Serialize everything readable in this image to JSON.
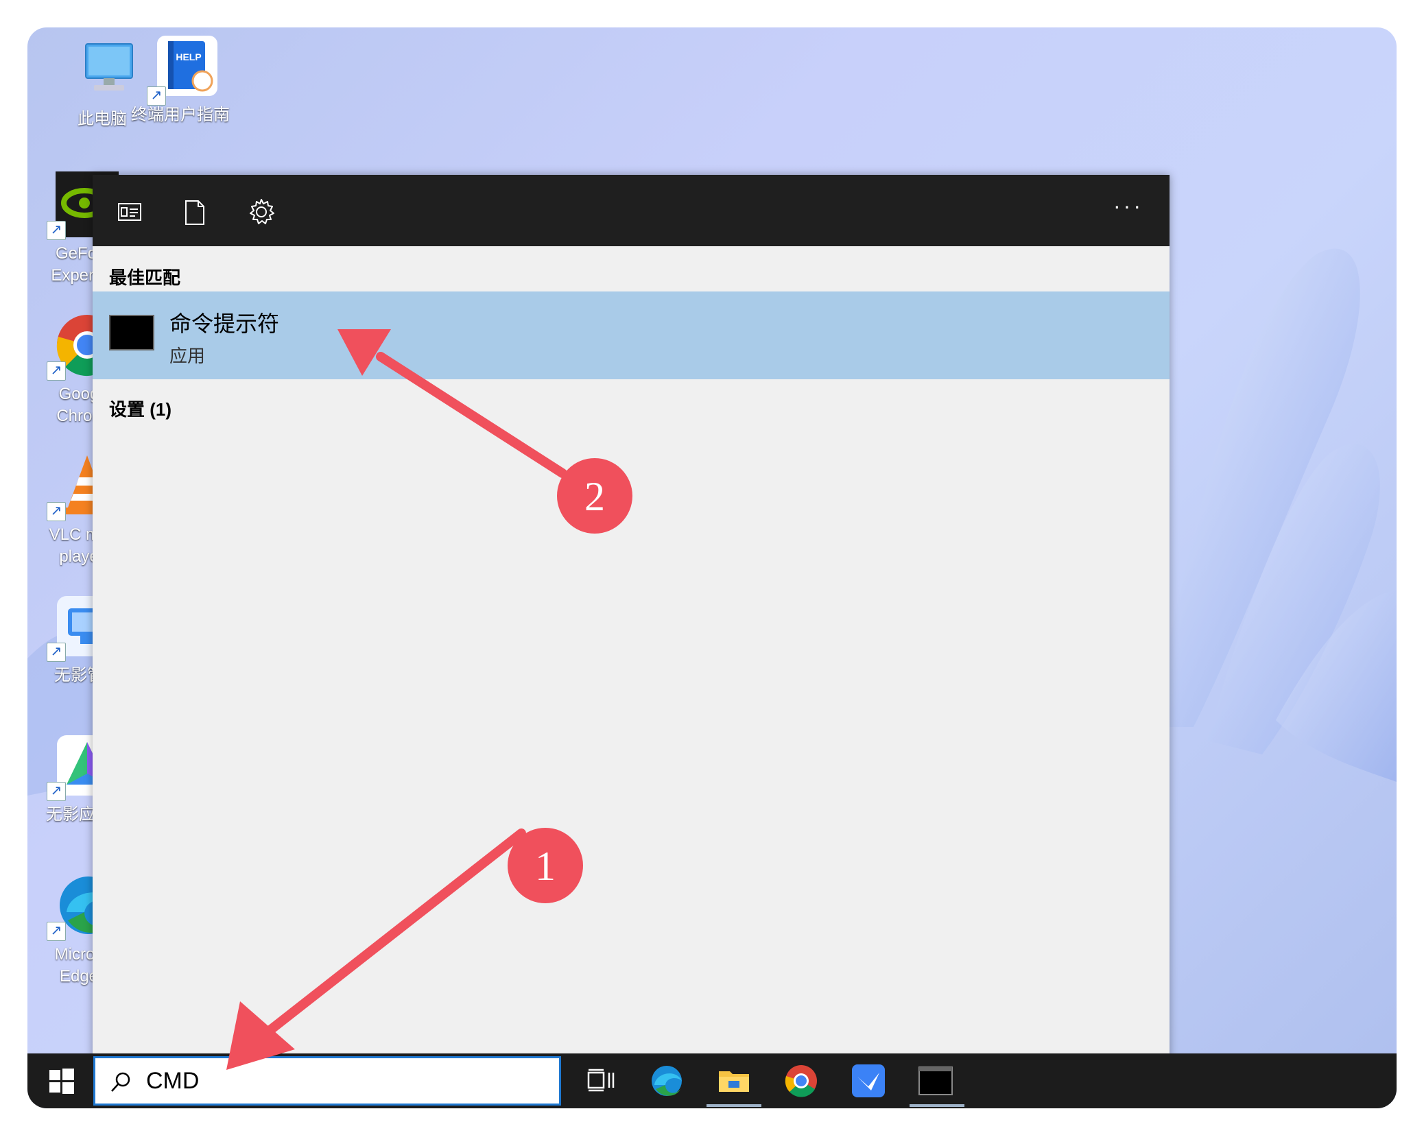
{
  "desktop": {
    "icons": [
      {
        "label": "此电脑"
      },
      {
        "label": "终端用户指南",
        "badge": "HELP"
      },
      {
        "label": "GeFor\nExperie"
      },
      {
        "label": "Goog\nChron"
      },
      {
        "label": "VLC me\nplaye"
      },
      {
        "label": "无影管"
      },
      {
        "label": "无影应用"
      },
      {
        "label": "Micros\nEdge"
      }
    ]
  },
  "search_panel": {
    "header_icons": [
      "documents-view-icon",
      "document-icon",
      "settings-gear-icon"
    ],
    "more_label": "···",
    "best_match_heading": "最佳匹配",
    "result": {
      "title": "命令提示符",
      "subtitle": "应用"
    },
    "settings_heading": "设置 (1)"
  },
  "taskbar": {
    "search_value": "CMD",
    "apps": [
      "task-view-icon",
      "edge-icon",
      "file-explorer-icon",
      "chrome-icon",
      "feishu-icon",
      "cmd-icon"
    ]
  },
  "annotations": {
    "badge_1": "1",
    "badge_2": "2",
    "color": "#f0505c"
  }
}
